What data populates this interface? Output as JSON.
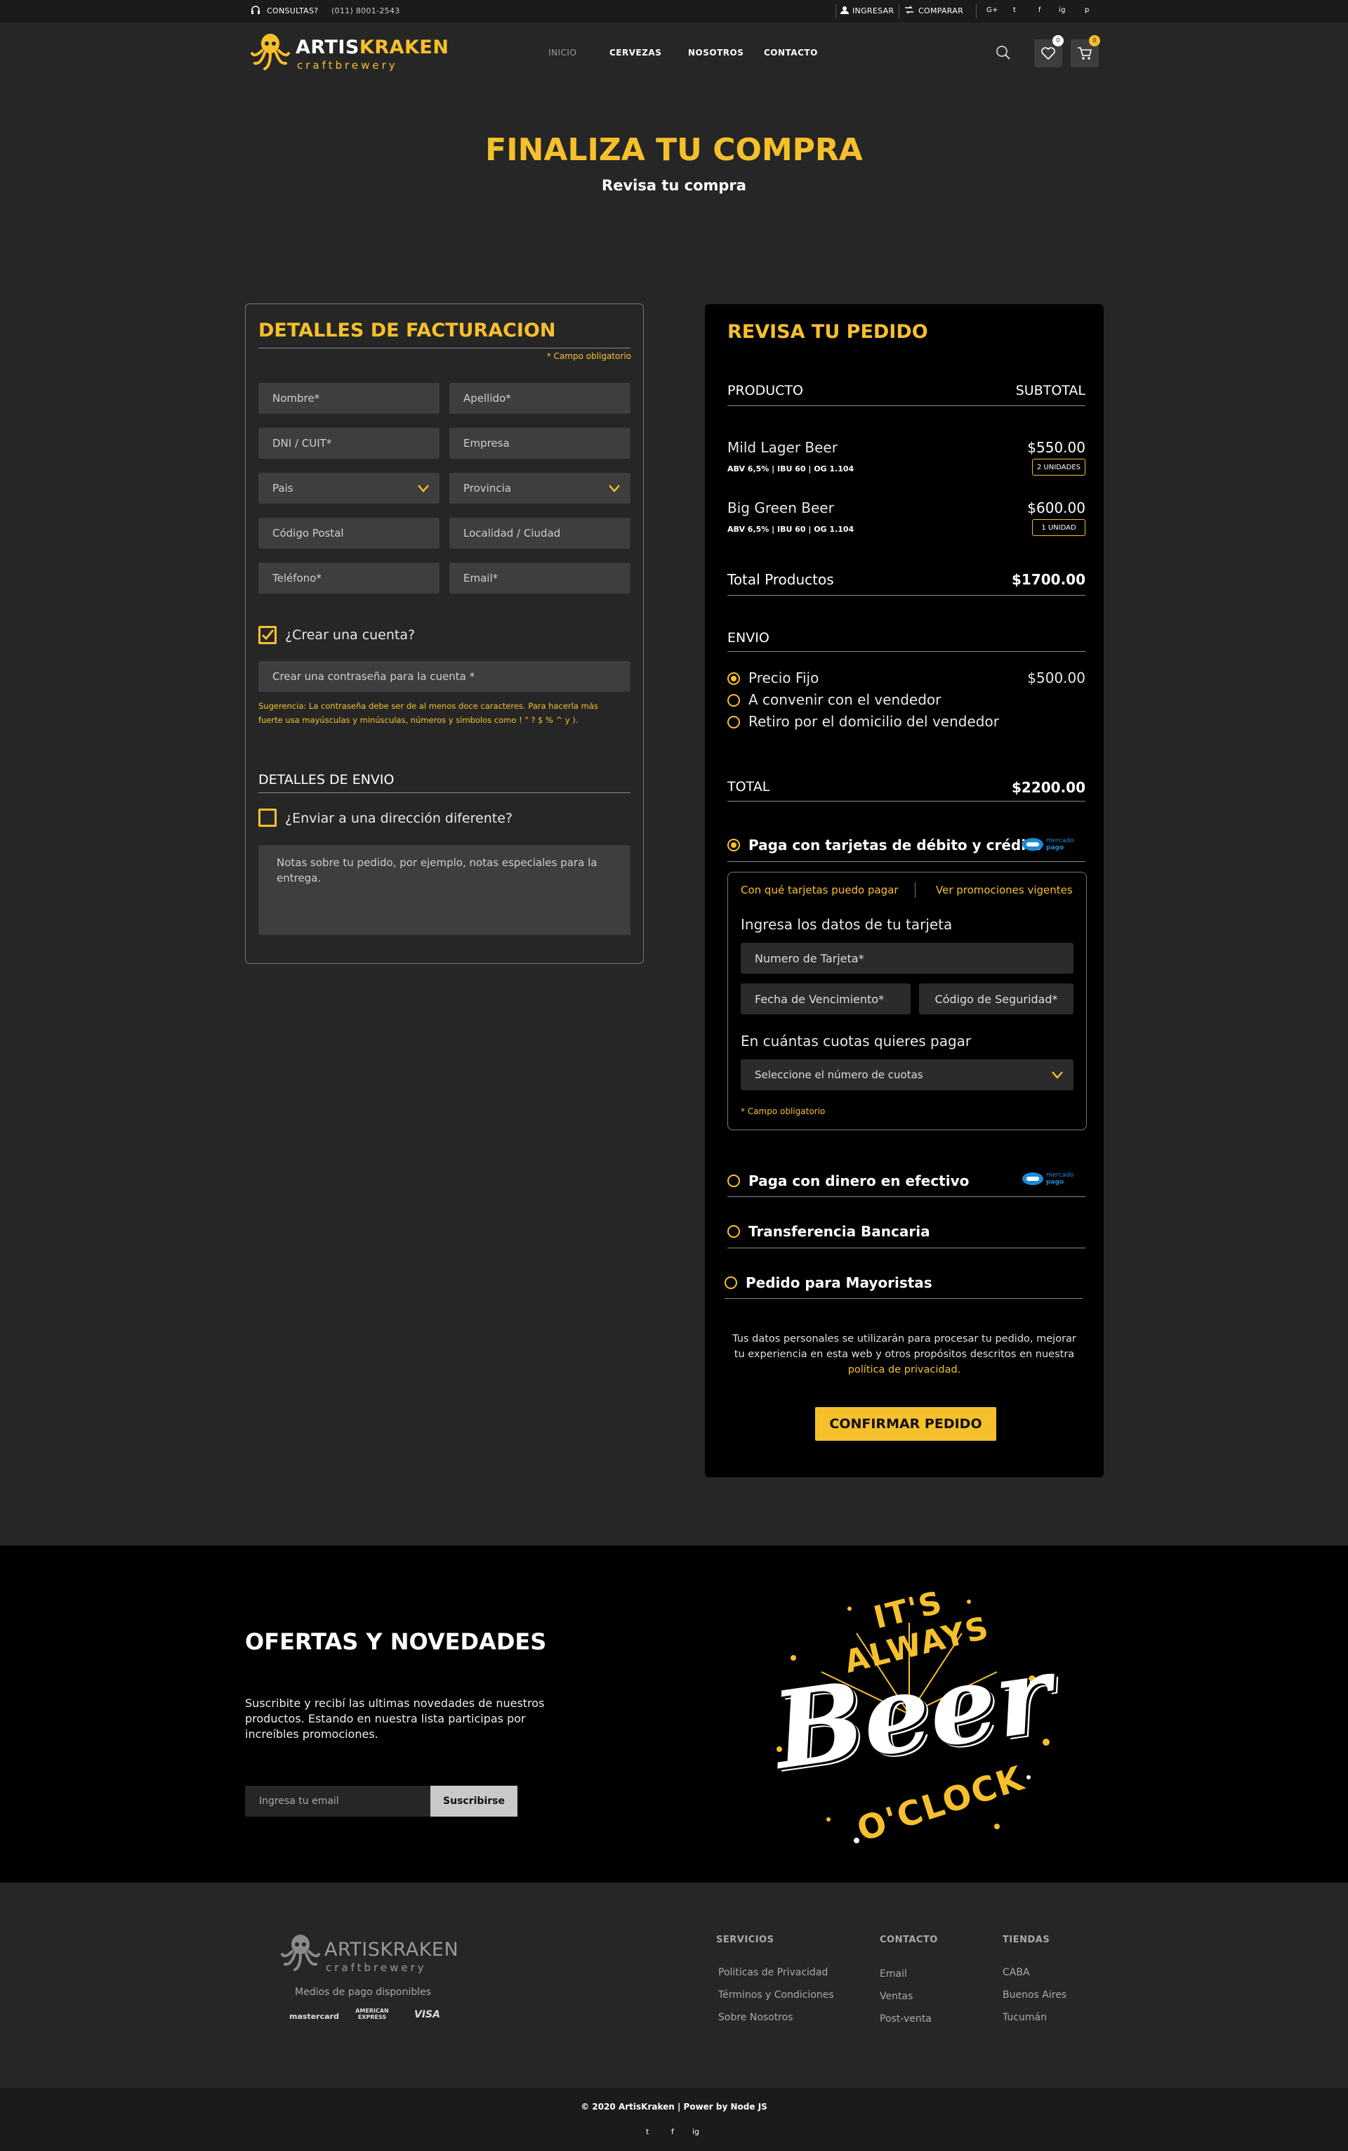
{
  "topbar": {
    "consultas": "CONSULTAS?",
    "phone": "(011) 8001-2543",
    "ingresar": "INGRESAR",
    "comparar": "COMPARAR",
    "social": [
      "G+",
      "t",
      "f",
      "ig",
      "p"
    ]
  },
  "brand": {
    "name_a": "ARTIS",
    "name_b": "KRAKEN",
    "tagline": "craftbrewery"
  },
  "nav": {
    "items": [
      "INICIO",
      "CERVEZAS",
      "NOSOTROS",
      "CONTACTO"
    ],
    "wishlist_count": "0",
    "cart_count": "0"
  },
  "hero": {
    "title": "FINALIZA TU COMPRA",
    "subtitle": "Revisa tu compra"
  },
  "billing": {
    "title": "DETALLES DE FACTURACION",
    "required_note": "* Campo obligatorio",
    "fields": {
      "nombre": "Nombre*",
      "apellido": "Apellido*",
      "dni": "DNI / CUIT*",
      "empresa": "Empresa",
      "pais": "Pais",
      "provincia": "Provincia",
      "cp": "Código Postal",
      "localidad": "Localidad / Ciudad",
      "telefono": "Teléfono*",
      "email": "Email*"
    },
    "create_account": "¿Crear una cuenta?",
    "password_placeholder": "Crear una contraseña para la cuenta *",
    "suggestion_line1": "Sugerencia: La contraseña debe ser de al menos doce caracteres. Para hacerla más",
    "suggestion_line2": "fuerte usa mayúsculas y minúsculas, números y símbolos como ! \" ? $ % ^ y ).",
    "shipping_title": "DETALLES DE ENVIO",
    "ship_different": "¿Enviar a una dirección diferente?",
    "notes_placeholder": "Notas sobre tu pedido, por ejemplo, notas especiales para la entrega."
  },
  "order": {
    "title": "REVISA TU PEDIDO",
    "col_product": "PRODUCTO",
    "col_subtotal": "SUBTOTAL",
    "items": [
      {
        "name": "Mild Lager Beer",
        "specs": "ABV 6,5% | IBU 60 | OG 1.104",
        "price": "$550.00",
        "qty": "2 UNIDADES"
      },
      {
        "name": "Big Green Beer",
        "specs": "ABV 6,5% | IBU 60 | OG 1.104",
        "price": "$600.00",
        "qty": "1 UNIDAD"
      }
    ],
    "total_products_label": "Total Productos",
    "total_products": "$1700.00",
    "shipping_label": "ENVIO",
    "shipping_options": [
      {
        "label": "Precio Fijo",
        "price": "$500.00",
        "selected": true
      },
      {
        "label": "A convenir con el vendedor",
        "selected": false
      },
      {
        "label": "Retiro por el domicilio del vendedor",
        "selected": false
      }
    ],
    "total_label": "TOTAL",
    "total": "$2200.00",
    "pay_card": "Paga con tarjetas de débito y crédito",
    "mp_text_1": "mercado",
    "mp_text_2": "pago",
    "card_link_1": "Con qué tarjetas puedo pagar",
    "card_link_2": "Ver promociones vigentes",
    "card_data_title": "Ingresa los datos de tu tarjeta",
    "card_number": "Numero de Tarjeta*",
    "card_expiry": "Fecha de Vencimiento*",
    "card_cvv": "Código de Seguridad*",
    "installments_title": "En cuántas cuotas quieres pagar",
    "installments_placeholder": "Seleccione el número de cuotas",
    "card_required": "* Campo obligatorio",
    "pay_cash": "Paga con dinero en efectivo",
    "pay_transfer": "Transferencia Bancaria",
    "pay_wholesale": "Pedido para Mayoristas",
    "privacy_line1": "Tus datos personales se utilizarán para procesar tu pedido, mejorar",
    "privacy_line2": "tu experiencia en esta web y otros propósitos descritos en nuestra",
    "privacy_link": "política de privacidad.",
    "confirm": "CONFIRMAR PEDIDO"
  },
  "newsletter": {
    "title": "OFERTAS Y NOVEDADES",
    "line1": "Suscribite y recibí las ultimas novedades de nuestros",
    "line2": "productos. Estando en nuestra lista participas por",
    "line3": "increíbles promociones.",
    "email_placeholder": "Ingresa tu email",
    "button": "Suscribirse",
    "art_top": "IT'S ALWAYS",
    "art_mid": "Beer",
    "art_bottom": "O'CLOCK"
  },
  "footer": {
    "payment_title": "Medios de pago disponibles",
    "payment_logos": [
      "mastercard",
      "AMERICAN EXPRESS",
      "VISA"
    ],
    "servicios_title": "SERVICIOS",
    "servicios": [
      "Politicas de Privacidad",
      "Términos y Condiciones",
      "Sobre Nosotros"
    ],
    "contacto_title": "CONTACTO",
    "contacto": [
      "Email",
      "Ventas",
      "Post-venta"
    ],
    "tiendas_title": "TIENDAS",
    "tiendas": [
      "CABA",
      "Buenos Aires",
      "Tucumán"
    ],
    "copyright": "© 2020 ArtisKraken | Power by Node JS",
    "social": [
      "t",
      "f",
      "ig"
    ]
  }
}
